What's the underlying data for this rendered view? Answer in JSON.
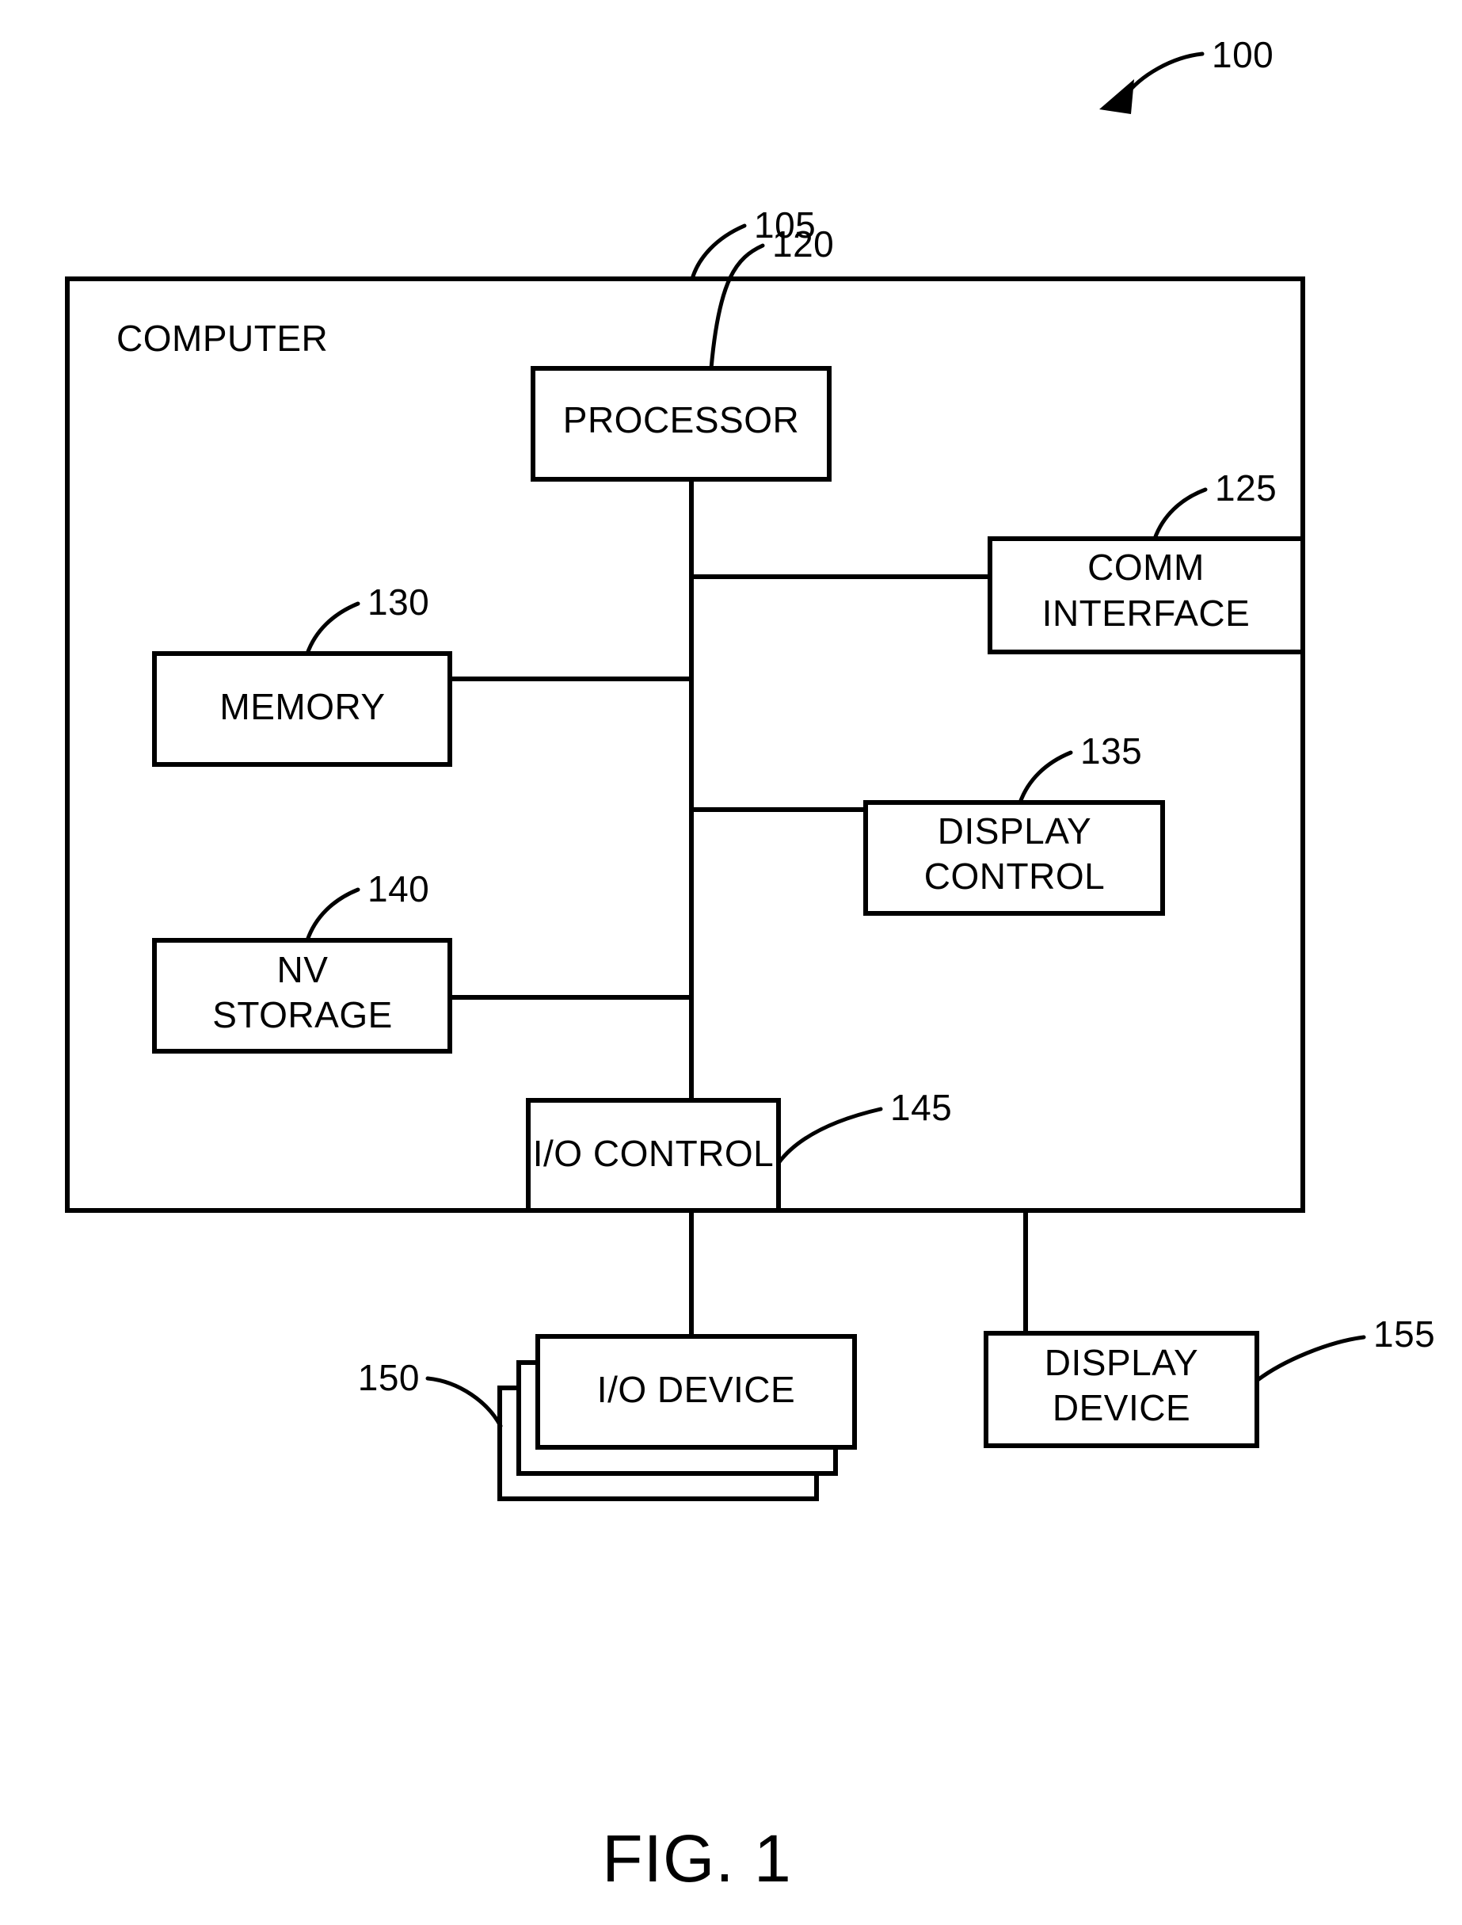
{
  "figure": {
    "caption": "FIG. 1",
    "system_ref": "100"
  },
  "blocks": [
    {
      "id": "computer",
      "label": "COMPUTER",
      "ref": "105"
    },
    {
      "id": "processor",
      "label": "PROCESSOR",
      "ref": "120"
    },
    {
      "id": "comm_interface",
      "label_line1": "COMM",
      "label_line2": "INTERFACE",
      "ref": "125"
    },
    {
      "id": "memory",
      "label": "MEMORY",
      "ref": "130"
    },
    {
      "id": "display_control",
      "label_line1": "DISPLAY",
      "label_line2": "CONTROL",
      "ref": "135"
    },
    {
      "id": "nv_storage",
      "label_line1": "NV",
      "label_line2": "STORAGE",
      "ref": "140"
    },
    {
      "id": "io_control",
      "label": "I/O CONTROL",
      "ref": "145"
    },
    {
      "id": "io_device",
      "label": "I/O DEVICE",
      "ref": "150"
    },
    {
      "id": "display_device",
      "label_line1": "DISPLAY",
      "label_line2": "DEVICE",
      "ref": "155"
    }
  ],
  "labels": {
    "computer": "COMPUTER",
    "processor": "PROCESSOR",
    "comm_interface_1": "COMM",
    "comm_interface_2": "INTERFACE",
    "memory": "MEMORY",
    "display_control_1": "DISPLAY",
    "display_control_2": "CONTROL",
    "nv_storage_1": "NV",
    "nv_storage_2": "STORAGE",
    "io_control": "I/O CONTROL",
    "io_device": "I/O DEVICE",
    "display_device_1": "DISPLAY",
    "display_device_2": "DEVICE"
  },
  "refs": {
    "system": "100",
    "computer": "105",
    "processor": "120",
    "comm_interface": "125",
    "memory": "130",
    "display_control": "135",
    "nv_storage": "140",
    "io_control": "145",
    "io_device": "150",
    "display_device": "155"
  },
  "colors": {
    "stroke": "#000000",
    "background": "#ffffff"
  }
}
